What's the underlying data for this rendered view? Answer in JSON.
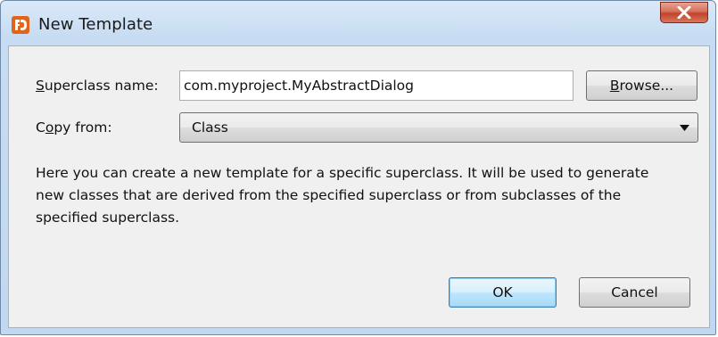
{
  "window": {
    "title": "New Template"
  },
  "form": {
    "superclass_label_accel": "S",
    "superclass_label_rest": "uperclass name:",
    "superclass_value": "com.myproject.MyAbstractDialog",
    "browse_label_accel": "B",
    "browse_label_rest": "rowse...",
    "copy_label_pre": "C",
    "copy_label_accel": "o",
    "copy_label_rest": "py from:",
    "copy_selected": "Class"
  },
  "description": "Here you can create a new template for a specific superclass. It will be used to generate new classes that are derived from the specified superclass or from subclasses of the specified superclass.",
  "buttons": {
    "ok": "OK",
    "cancel": "Cancel"
  },
  "icons": {
    "app": "app-logo-icon",
    "close": "close-icon",
    "dropdown": "chevron-down-icon"
  },
  "colors": {
    "app_icon": "#e2631b",
    "close_button": "#c2432a"
  }
}
